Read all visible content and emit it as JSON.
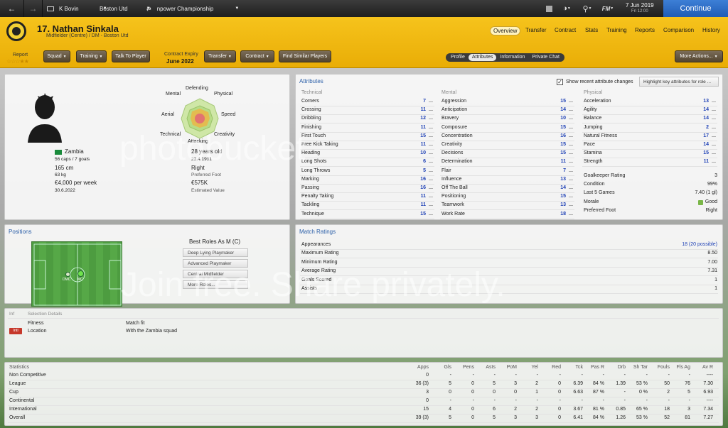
{
  "topbar": {
    "manager": "K Bovin",
    "club": "Boston Utd",
    "league": "npower Championship",
    "fm_label": "FM",
    "date": "7 Jun 2019",
    "time": "Fri 12:00",
    "continue_label": "Continue"
  },
  "player": {
    "name": "17. Nathan Sinkala",
    "position_line": "Midfielder (Centre) / DM - Boston Utd",
    "report_label": "Report",
    "contract_label": "Contract Expiry",
    "contract_value": "June 2022"
  },
  "nav": {
    "tabs": [
      "Overview",
      "Transfer",
      "Contract",
      "Stats",
      "Training",
      "Reports",
      "Comparison",
      "History"
    ],
    "subtabs": [
      "Profile",
      "Attributes",
      "Information",
      "Private Chat"
    ]
  },
  "header_buttons": [
    "Squad",
    "Training",
    "Talk To Player",
    "Transfer",
    "Contract",
    "Find Similar Players",
    "More Actions..."
  ],
  "profile": {
    "nation": "Zambia",
    "caps": "56 caps / 7 goals",
    "height": "165 cm",
    "weight": "63 kg",
    "wage": "€4,000 per week",
    "contract_end": "30.6.2022",
    "age": "28 years old",
    "dob": "23.4.1991",
    "foot": "Right",
    "foot_label": "Preferred Foot",
    "value": "€575K",
    "value_label": "Estimated Value"
  },
  "radar_labels": [
    "Defending",
    "Physical",
    "Speed",
    "Creativity",
    "Attacking",
    "Technical",
    "Aerial",
    "Mental"
  ],
  "attributes": {
    "title": "Attributes",
    "checkbox_label": "Show recent attribute changes",
    "highlight_label": "Highlight key attributes for role ...",
    "technical_title": "Technical",
    "mental_title": "Mental",
    "physical_title": "Physical",
    "technical": [
      {
        "name": "Corners",
        "value": "7"
      },
      {
        "name": "Crossing",
        "value": "11"
      },
      {
        "name": "Dribbling",
        "value": "12"
      },
      {
        "name": "Finishing",
        "value": "11"
      },
      {
        "name": "First Touch",
        "value": "15"
      },
      {
        "name": "Free Kick Taking",
        "value": "11"
      },
      {
        "name": "Heading",
        "value": "10"
      },
      {
        "name": "Long Shots",
        "value": "6"
      },
      {
        "name": "Long Throws",
        "value": "5"
      },
      {
        "name": "Marking",
        "value": "16"
      },
      {
        "name": "Passing",
        "value": "16"
      },
      {
        "name": "Penalty Taking",
        "value": "11"
      },
      {
        "name": "Tackling",
        "value": "11"
      },
      {
        "name": "Technique",
        "value": "15"
      }
    ],
    "mental": [
      {
        "name": "Aggression",
        "value": "15"
      },
      {
        "name": "Anticipation",
        "value": "14"
      },
      {
        "name": "Bravery",
        "value": "10"
      },
      {
        "name": "Composure",
        "value": "15"
      },
      {
        "name": "Concentration",
        "value": "16"
      },
      {
        "name": "Creativity",
        "value": "15"
      },
      {
        "name": "Decisions",
        "value": "15"
      },
      {
        "name": "Determination",
        "value": "11"
      },
      {
        "name": "Flair",
        "value": "7"
      },
      {
        "name": "Influence",
        "value": "13"
      },
      {
        "name": "Off The Ball",
        "value": "14"
      },
      {
        "name": "Positioning",
        "value": "15"
      },
      {
        "name": "Teamwork",
        "value": "13"
      },
      {
        "name": "Work Rate",
        "value": "18"
      }
    ],
    "physical": [
      {
        "name": "Acceleration",
        "value": "13"
      },
      {
        "name": "Agility",
        "value": "14"
      },
      {
        "name": "Balance",
        "value": "14"
      },
      {
        "name": "Jumping",
        "value": "2"
      },
      {
        "name": "Natural Fitness",
        "value": "17"
      },
      {
        "name": "Pace",
        "value": "14"
      },
      {
        "name": "Stamina",
        "value": "15"
      },
      {
        "name": "Strength",
        "value": "11"
      }
    ],
    "extra": [
      {
        "name": "Goalkeeper Rating",
        "value": "3"
      },
      {
        "name": "Condition",
        "value": "99%"
      },
      {
        "name": "Last 5 Games",
        "value": "7.40 (1 gl)"
      },
      {
        "name": "Morale",
        "value": "Good"
      },
      {
        "name": "Preferred Foot",
        "value": "Right"
      }
    ]
  },
  "positions": {
    "title": "Positions",
    "best_roles_title": "Best Roles As M (C)",
    "roles": [
      "Deep Lying Playmaker",
      "Advanced Playmaker",
      "Central Midfielder",
      "More Roles..."
    ],
    "dots": [
      "DMC",
      "MC"
    ]
  },
  "match_ratings": {
    "title": "Match Ratings",
    "rows": [
      {
        "name": "Appearances",
        "value": "18 (20 possible)"
      },
      {
        "name": "Maximum Rating",
        "value": "8.50"
      },
      {
        "name": "Minimum Rating",
        "value": "7.00"
      },
      {
        "name": "Average Rating",
        "value": "7.31"
      },
      {
        "name": "Goals Scored",
        "value": "1"
      },
      {
        "name": "Assists",
        "value": "1"
      }
    ]
  },
  "info": {
    "tab1": "Inf",
    "tab2": "Selection Details",
    "rows": [
      {
        "badge": "",
        "name": "Fitness",
        "value": "Match fit"
      },
      {
        "badge": "Intl",
        "name": "Location",
        "value": "With the Zambia squad"
      }
    ]
  },
  "stats": {
    "title": "Statistics",
    "columns": [
      "Apps",
      "Gls",
      "Pens",
      "Asts",
      "PoM",
      "Yel",
      "Red",
      "Tck",
      "Pas R",
      "Drb",
      "Sh Tar",
      "Fouls",
      "Fls Ag",
      "Av R"
    ],
    "rows": [
      {
        "name": "Non Competitive",
        "cells": [
          "0",
          "-",
          "-",
          "-",
          "-",
          "-",
          "-",
          "-",
          "-",
          "-",
          "-",
          "-",
          "-",
          "----"
        ]
      },
      {
        "name": "League",
        "cells": [
          "36 (3)",
          "5",
          "0",
          "5",
          "3",
          "2",
          "0",
          "6.39",
          "84 %",
          "1.39",
          "53 %",
          "50",
          "76",
          "7.30"
        ]
      },
      {
        "name": "Cup",
        "cells": [
          "3",
          "0",
          "0",
          "0",
          "0",
          "1",
          "0",
          "6.63",
          "87 %",
          "-",
          "0 %",
          "2",
          "5",
          "6.93"
        ]
      },
      {
        "name": "Continental",
        "cells": [
          "0",
          "-",
          "-",
          "-",
          "-",
          "-",
          "-",
          "-",
          "-",
          "-",
          "-",
          "-",
          "-",
          "----"
        ]
      },
      {
        "name": "International",
        "cells": [
          "15",
          "4",
          "0",
          "6",
          "2",
          "2",
          "0",
          "3.67",
          "81 %",
          "0.85",
          "65 %",
          "18",
          "3",
          "7.34"
        ]
      },
      {
        "name": "Overall",
        "cells": [
          "39 (3)",
          "5",
          "0",
          "5",
          "3",
          "3",
          "0",
          "6.41",
          "84 %",
          "1.26",
          "53 %",
          "52",
          "81",
          "7.27"
        ]
      }
    ]
  },
  "watermark": {
    "line1": "photobucket",
    "line2": "Join free. Share privately."
  }
}
